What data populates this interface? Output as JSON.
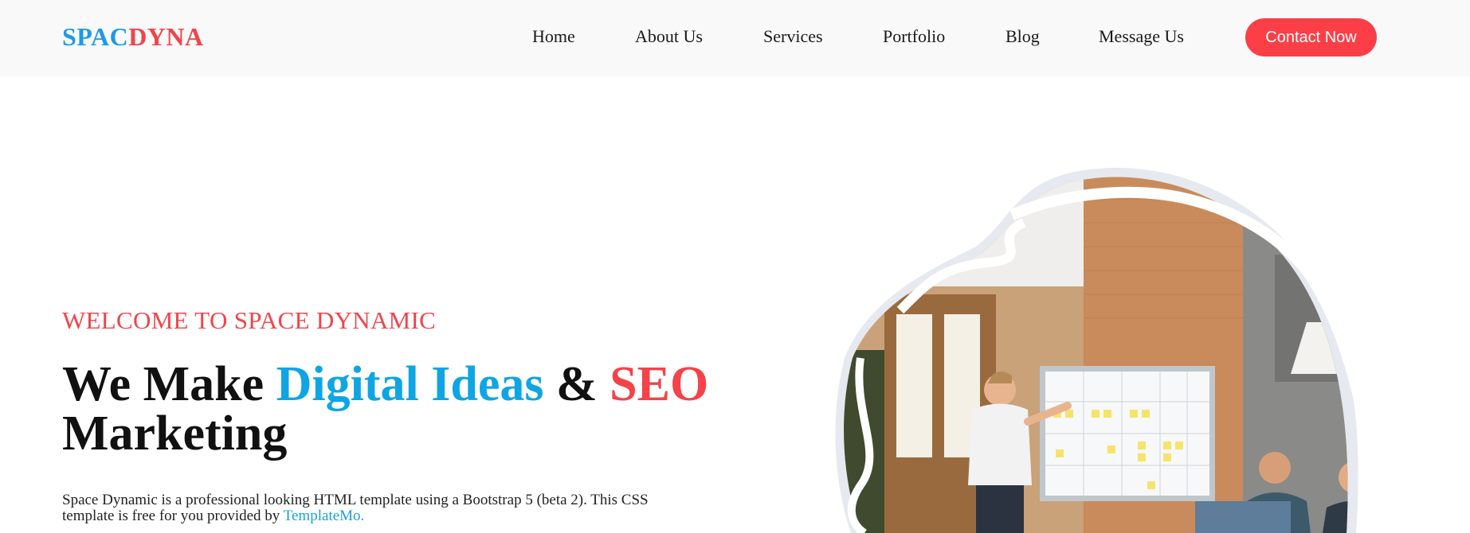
{
  "header": {
    "logo_part1": "SPAC",
    "logo_part2": "DYNA",
    "nav": [
      {
        "label": "Home"
      },
      {
        "label": "About Us"
      },
      {
        "label": "Services"
      },
      {
        "label": "Portfolio"
      },
      {
        "label": "Blog"
      },
      {
        "label": "Message Us"
      }
    ],
    "cta_label": "Contact Now"
  },
  "hero": {
    "welcome": "WELCOME TO SPACE DYNAMIC",
    "headline_part1": "We Make ",
    "headline_blue": "Digital Ideas",
    "headline_mid": " & ",
    "headline_red": "SEO",
    "headline_part2": "Marketing",
    "description": "Space Dynamic is a professional looking HTML template using a Bootstrap 5 (beta 2). This CSS template is free for you provided by ",
    "description_link": "TemplateMo."
  },
  "colors": {
    "brand_blue": "#1e9ae6",
    "brand_red": "#f44349",
    "cta_bg": "#fc3e47",
    "header_bg": "#f9f9f9"
  },
  "icons": {
    "hero_image": "office-presentation-illustration"
  }
}
